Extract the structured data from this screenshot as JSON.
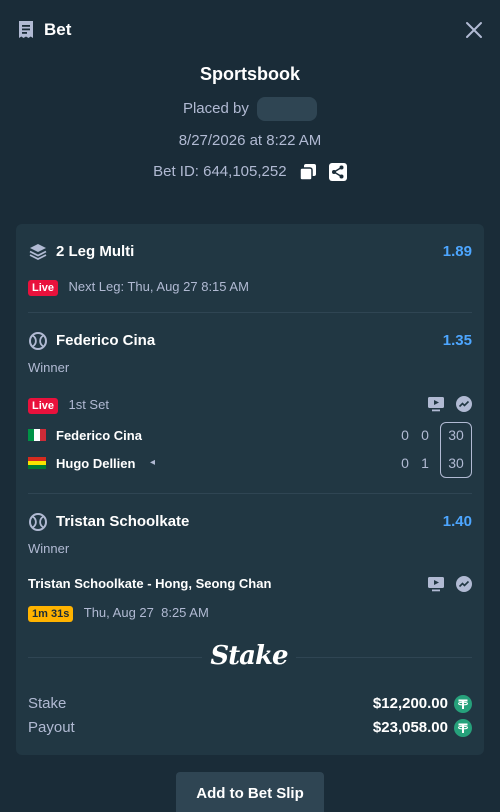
{
  "header": {
    "title": "Bet"
  },
  "summary": {
    "book": "Sportsbook",
    "placed_by_label": "Placed by",
    "datetime": "8/27/2026 at 8:22 AM",
    "bet_id": "Bet ID: 644,105,252"
  },
  "multi": {
    "title": "2 Leg Multi",
    "odds": "1.89",
    "live_label": "Live",
    "next_leg": "Next Leg: Thu, Aug 27 8:15 AM"
  },
  "leg1": {
    "title": "Federico Cina",
    "odds": "1.35",
    "market": "Winner",
    "live_label": "Live",
    "status": "1st Set",
    "players": [
      {
        "name": "Federico Cina",
        "sets": "0",
        "games": "0",
        "points": "30"
      },
      {
        "name": "Hugo Dellien",
        "sets": "0",
        "games": "1",
        "points": "30",
        "serving": "◂"
      }
    ]
  },
  "leg2": {
    "title": "Tristan Schoolkate",
    "odds": "1.40",
    "market": "Winner",
    "match": "Tristan Schoolkate - Hong, Seong Chan",
    "countdown": "1m 31s",
    "start": "Thu, Aug 27  8:25 AM"
  },
  "footer": {
    "brand": "Stake",
    "stake_label": "Stake",
    "stake_amount": "$12,200.00",
    "payout_label": "Payout",
    "payout_amount": "$23,058.00",
    "currency_icon": "tether-icon"
  },
  "actions": {
    "add_to_slip": "Add to Bet Slip"
  },
  "colors": {
    "background": "#1a2c38",
    "card": "#213743",
    "odds": "#4da6ff",
    "live": "#e9113c",
    "timer": "#ffb300",
    "tether": "#26a17b"
  }
}
